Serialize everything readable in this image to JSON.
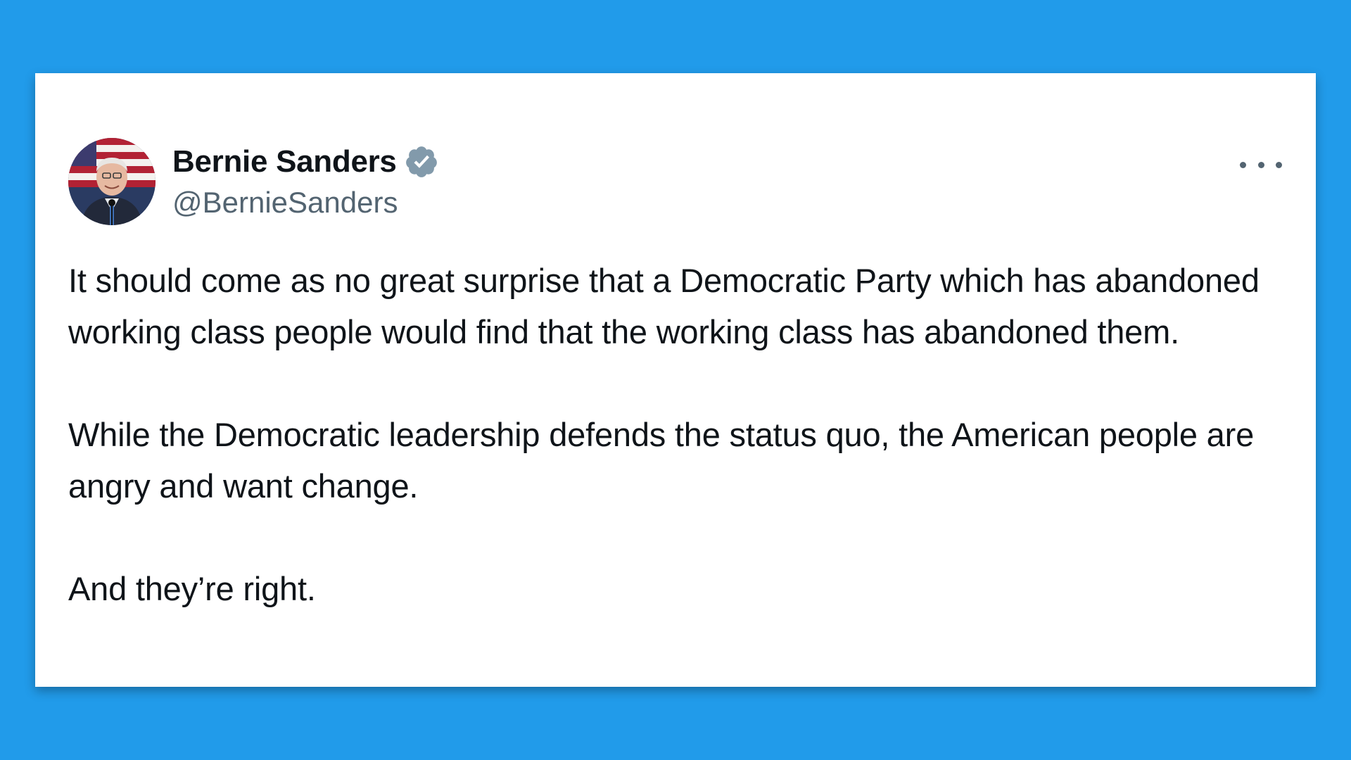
{
  "colors": {
    "background": "#219BEA",
    "card": "#FFFFFF",
    "name_text": "#0F1419",
    "secondary_text": "#536471",
    "verified_badge": "#829AAB"
  },
  "tweet": {
    "author": {
      "display_name": "Bernie Sanders",
      "handle": "@BernieSanders",
      "verified_icon": "verified-badge-icon",
      "avatar_icon": "profile-avatar"
    },
    "more_icon": "more-options-icon",
    "paragraphs": [
      "It should come as no great surprise that a Democratic Party which has abandoned working class people would find that the working class has abandoned them.",
      "While the Democratic leadership defends the status quo, the American people are angry and want change.",
      "And they’re right."
    ]
  }
}
